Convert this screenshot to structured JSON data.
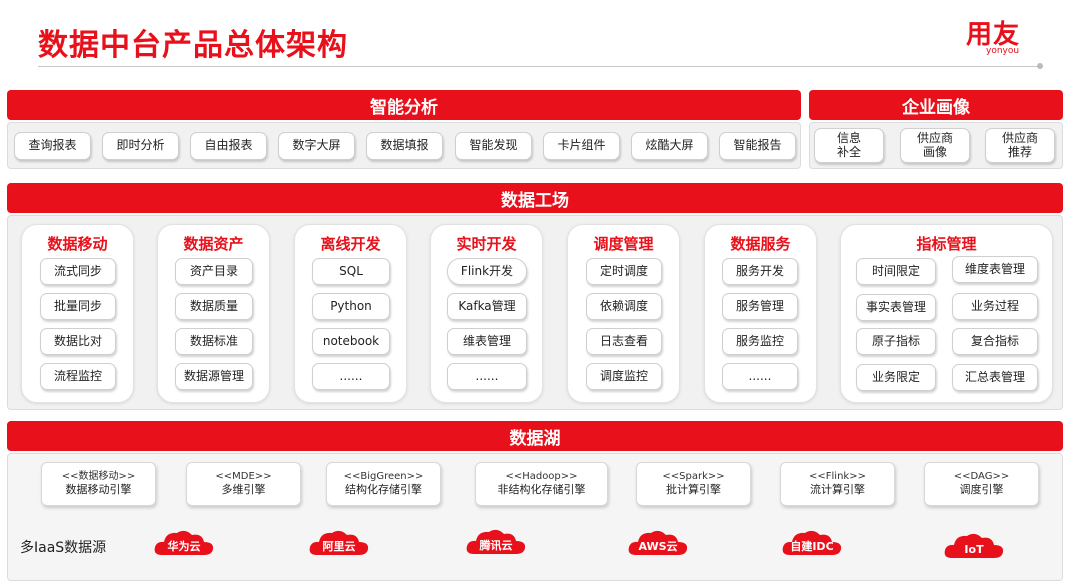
{
  "header": {
    "title": "数据中台产品总体架构",
    "logo_main": "用友",
    "logo_sub": "yonyou"
  },
  "analysis": {
    "title": "智能分析",
    "items": [
      "查询报表",
      "即时分析",
      "自由报表",
      "数字大屏",
      "数据填报",
      "智能发现",
      "卡片组件",
      "炫酷大屏",
      "智能报告"
    ]
  },
  "portrait": {
    "title": "企业画像",
    "items": [
      [
        "信息",
        "补全"
      ],
      [
        "供应商",
        "画像"
      ],
      [
        "供应商",
        "推荐"
      ]
    ]
  },
  "factory": {
    "title": "数据工场",
    "groups": [
      {
        "title": "数据移动",
        "items": [
          "流式同步",
          "批量同步",
          "数据比对",
          "流程监控"
        ]
      },
      {
        "title": "数据资产",
        "items": [
          "资产目录",
          "数据质量",
          "数据标准",
          "数据源管理"
        ]
      },
      {
        "title": "离线开发",
        "items": [
          "SQL",
          "Python",
          "notebook",
          "......"
        ]
      },
      {
        "title": "实时开发",
        "items": [
          "Flink开发",
          "Kafka管理",
          "维表管理",
          "......"
        ]
      },
      {
        "title": "调度管理",
        "items": [
          "定时调度",
          "依赖调度",
          "日志查看",
          "调度监控"
        ]
      },
      {
        "title": "数据服务",
        "items": [
          "服务开发",
          "服务管理",
          "服务监控",
          "......"
        ]
      }
    ],
    "indicator": {
      "title": "指标管理",
      "items": [
        "时间限定",
        "维度表管理",
        "事实表管理",
        "业务过程",
        "原子指标",
        "复合指标",
        "业务限定",
        "汇总表管理"
      ]
    }
  },
  "lake": {
    "title": "数据湖",
    "engines": [
      {
        "tag": "<<数据移动>>",
        "name": "数据移动引擎"
      },
      {
        "tag": "<<MDE>>",
        "name": "多维引擎"
      },
      {
        "tag": "<<BigGreen>>",
        "name": "结构化存储引擎"
      },
      {
        "tag": "<<Hadoop>>",
        "name": "非结构化存储引擎"
      },
      {
        "tag": "<<Spark>>",
        "name": "批计算引擎"
      },
      {
        "tag": "<<Flink>>",
        "name": "流计算引擎"
      },
      {
        "tag": "<<DAG>>",
        "name": "调度引擎"
      }
    ],
    "iaas_label": "多IaaS数据源",
    "clouds": [
      "华为云",
      "阿里云",
      "腾讯云",
      "AWS云",
      "自建IDC",
      "IoT"
    ]
  },
  "colors": {
    "accent": "#e8101a",
    "panel": "#f1f1f1"
  }
}
